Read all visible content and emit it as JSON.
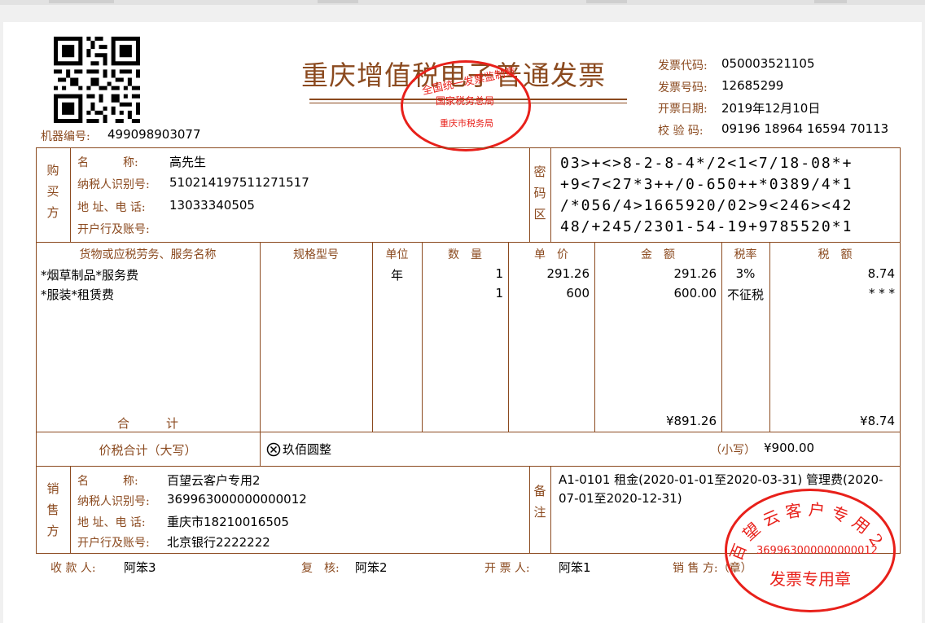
{
  "invoice": {
    "title": "重庆增值税电子普通发票",
    "machine_no_label": "机器编号:",
    "machine_no": "499098903077",
    "code_label": "发票代码:",
    "code": "050003521105",
    "number_label": "发票号码:",
    "number": "12685299",
    "date_label": "开票日期:",
    "date": "2019年12月10日",
    "check_label": "校 验 码:",
    "check_code": "09196 18964 16594 70113"
  },
  "tax_stamp": {
    "top": "全国统一发票监制章",
    "middle": "国家税务总局",
    "bottom": "重庆市税务局"
  },
  "buyer": {
    "section_label": "购买方",
    "name_label": "名　　　称:",
    "name": "高先生",
    "tax_id_label": "纳税人识别号:",
    "tax_id": "510214197511271517",
    "address_label": "地 址、电 话:",
    "address": "13033340505",
    "bank_label": "开户行及账号:",
    "bank": ""
  },
  "cipher": {
    "label": "密码区",
    "lines": [
      "03>+<>8-2-8-4*/2<1<7/18-08*+",
      "+9<7<27*3++/0-650++*0389/4*1",
      "/*056/4>1665920/02>9<246><42",
      "48/+245/2301-54-19+9785520*1"
    ]
  },
  "items": {
    "headers": {
      "name": "货物或应税劳务、服务名称",
      "spec": "规格型号",
      "unit": "单位",
      "qty": "数　量",
      "price": "单　价",
      "amount": "金　额",
      "rate": "税率",
      "tax": "税　额"
    },
    "rows": [
      {
        "name": "*烟草制品*服务费",
        "spec": "",
        "unit": "年",
        "qty": "1",
        "price": "291.26",
        "amount": "291.26",
        "rate": "3%",
        "tax": "8.74"
      },
      {
        "name": "*服装*租赁费",
        "spec": "",
        "unit": "",
        "qty": "1",
        "price": "600",
        "amount": "600.00",
        "rate": "不征税",
        "tax": "* * *"
      }
    ],
    "total_label": "合　　　计",
    "total_amount": "¥891.26",
    "total_tax": "¥8.74"
  },
  "grand_total": {
    "label": "价税合计（大写）",
    "uppercase_icon": "circled-x-icon",
    "uppercase": "玖佰圆整",
    "lowercase_label": "（小写）",
    "lowercase": "¥900.00"
  },
  "seller": {
    "section_label": "销售方",
    "name_label": "名　　　称:",
    "name": "百望云客户专用2",
    "tax_id_label": "纳税人识别号:",
    "tax_id": "369963000000000012",
    "address_label": "地 址、电 话:",
    "address": "重庆市18210016505",
    "bank_label": "开户行及账号:",
    "bank": "北京银行2222222"
  },
  "remarks": {
    "label": "备注",
    "text": "A1-0101 租金(2020-01-01至2020-03-31) 管理费(2020-07-01至2020-12-31)"
  },
  "seller_stamp": {
    "arc_text": "百望云客户专用2",
    "tax_id": "369963000000000012",
    "bottom": "发票专用章"
  },
  "footer": {
    "payee_label": "收 款 人:",
    "payee": "阿笨3",
    "reviewer_label": "复　核:",
    "reviewer": "阿笨2",
    "issuer_label": "开 票 人:",
    "issuer": "阿笨1",
    "seller_label": "销 售 方:（章）"
  },
  "colors": {
    "frame": "#8b4a1f",
    "stamp": "#e8201a"
  }
}
